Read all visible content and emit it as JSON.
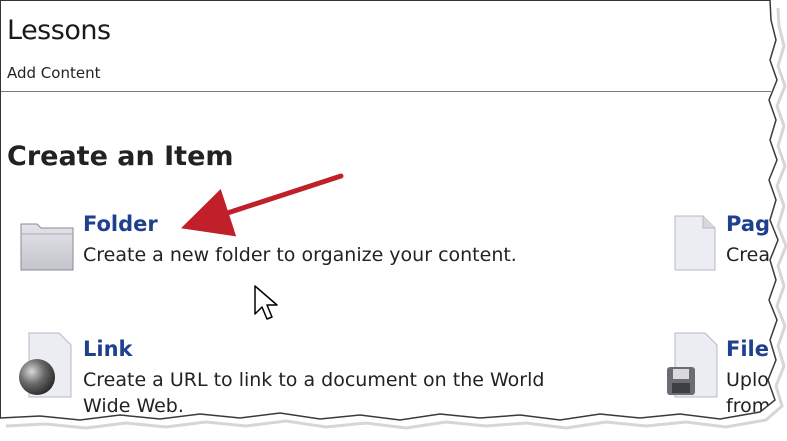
{
  "header": {
    "title": "Lessons",
    "subtitle": "Add Content"
  },
  "section": {
    "title": "Create an Item"
  },
  "items": [
    {
      "label": "Folder",
      "desc1": "Create a new folder to organize your content.",
      "desc2": "",
      "icon": "folder-icon"
    },
    {
      "label": "Pag",
      "desc1": "Crea",
      "desc2": "",
      "icon": "page-icon"
    },
    {
      "label": "Link",
      "desc1": "Create a URL to link to a document on the World",
      "desc2": "Wide Web.",
      "icon": "link-globe-icon"
    },
    {
      "label": "File",
      "desc1": "Uplo",
      "desc2": "from",
      "icon": "file-disk-icon"
    }
  ],
  "colors": {
    "link": "#1f3f8f",
    "annotation_arrow": "#c0202a"
  }
}
